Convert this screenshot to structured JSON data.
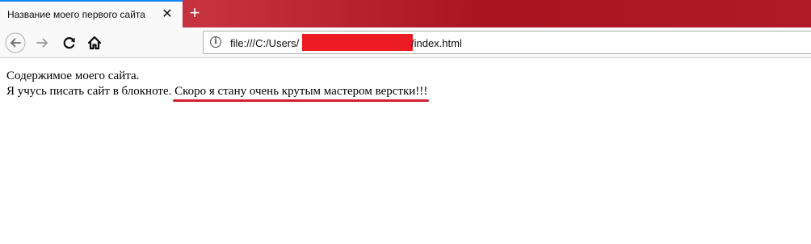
{
  "browser": {
    "tab": {
      "title": "Название моего первого сайта",
      "close_glyph": "✕"
    },
    "new_tab_glyph": "+",
    "nav": {
      "back_icon": "back-arrow-icon",
      "forward_icon": "forward-arrow-icon",
      "reload_icon": "reload-icon",
      "home_icon": "home-icon"
    },
    "url": {
      "info_glyph": "i",
      "prefix": "file:///C:/Users/",
      "suffix": "/index.html",
      "redaction_color": "#ed1c24"
    },
    "colors": {
      "titlebar": "#b5202f",
      "tab_accent": "#0a84ff",
      "annotation": "#d21f2f"
    }
  },
  "page": {
    "line1": "Содержимое моего сайта.",
    "line2_plain": "Я учусь писать сайт в блокноте. ",
    "line2_highlight": "Скоро я стану очень крутым мастером верстки!!!"
  }
}
